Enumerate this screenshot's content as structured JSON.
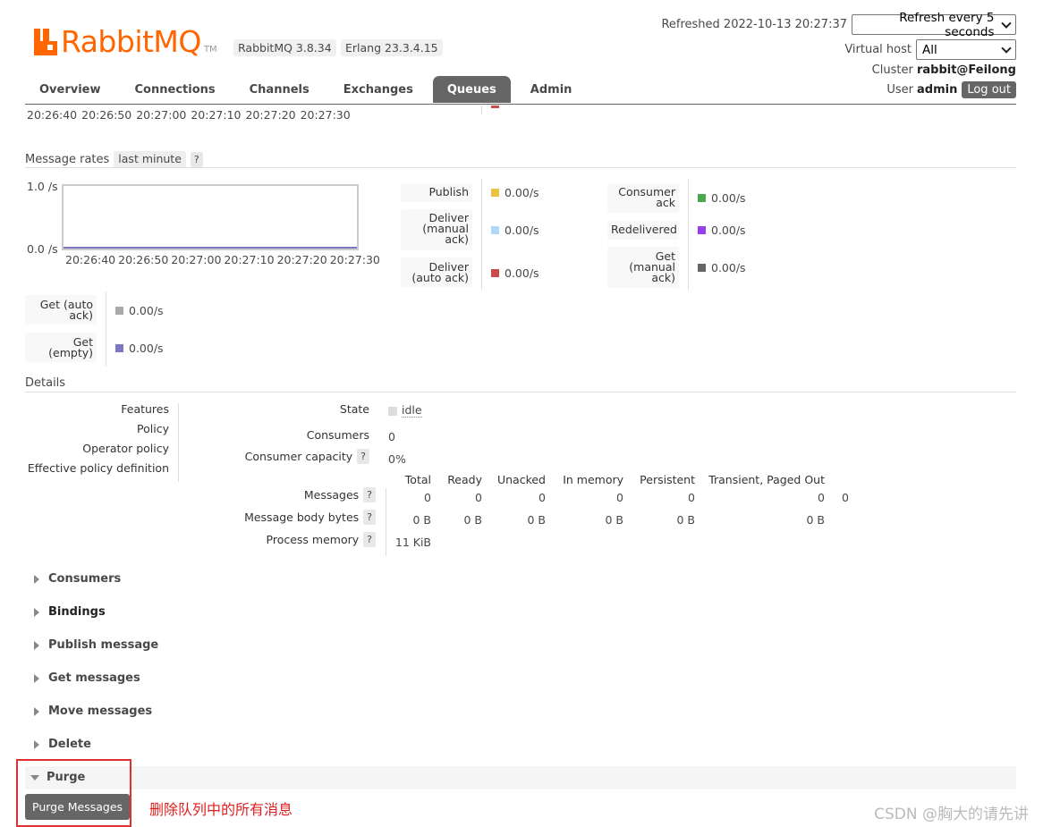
{
  "header": {
    "logo_text": "RabbitMQ",
    "logo_tm": "TM",
    "rabbit_version": "RabbitMQ 3.8.34",
    "erlang_version": "Erlang 23.3.4.15",
    "refreshed_label": "Refreshed 2022-10-13 20:27:37",
    "refresh_select": "Refresh every 5 seconds",
    "vhost_label": "Virtual host",
    "vhost_select": "All",
    "cluster_label": "Cluster",
    "cluster_name": "rabbit@Feilong",
    "user_label": "User",
    "user_name": "admin",
    "logout_label": "Log out"
  },
  "tabs": [
    {
      "label": "Overview"
    },
    {
      "label": "Connections"
    },
    {
      "label": "Channels"
    },
    {
      "label": "Exchanges"
    },
    {
      "label": "Queues"
    },
    {
      "label": "Admin"
    }
  ],
  "prev_chart_ticks": "20:26:40 20:26:50 20:27:00 20:27:10 20:27:20 20:27:30",
  "message_rates": {
    "title": "Message rates",
    "range": "last minute",
    "help": "?",
    "y_top": "1.0 /s",
    "y_bottom": "0.0 /s",
    "x_ticks": [
      "20:26:40",
      "20:26:50",
      "20:27:00",
      "20:27:10",
      "20:27:20",
      "20:27:30"
    ],
    "rates": [
      {
        "label": "Publish",
        "value": "0.00/s",
        "color": "#edc240"
      },
      {
        "label": "Deliver (manual ack)",
        "value": "0.00/s",
        "color": "#afd8f8"
      },
      {
        "label": "Deliver (auto ack)",
        "value": "0.00/s",
        "color": "#cb4b4b"
      },
      {
        "label": "Consumer ack",
        "value": "0.00/s",
        "color": "#4da74d"
      },
      {
        "label": "Redelivered",
        "value": "0.00/s",
        "color": "#9440ed"
      },
      {
        "label": "Get (manual ack)",
        "value": "0.00/s",
        "color": "#666666"
      },
      {
        "label": "Get (auto ack)",
        "value": "0.00/s",
        "color": "#aaaaaa"
      },
      {
        "label": "Get (empty)",
        "value": "0.00/s",
        "color": "#7c79c3"
      }
    ]
  },
  "details": {
    "title": "Details",
    "left_labels": [
      "Features",
      "Policy",
      "Operator policy",
      "Effective policy definition"
    ],
    "state_label": "State",
    "state_value": "idle",
    "consumers_label": "Consumers",
    "consumers_value": "0",
    "capacity_label": "Consumer capacity",
    "capacity_value": "0%",
    "columns": [
      "Total",
      "Ready",
      "Unacked",
      "In memory",
      "Persistent",
      "Transient, Paged Out"
    ],
    "rows": [
      {
        "label": "Messages",
        "values": [
          "0",
          "0",
          "0",
          "0",
          "0",
          "0"
        ],
        "extra": "0"
      },
      {
        "label": "Message body bytes",
        "values": [
          "0 B",
          "0 B",
          "0 B",
          "0 B",
          "0 B",
          "0 B"
        ]
      },
      {
        "label": "Process memory",
        "values": [
          "11 KiB"
        ]
      }
    ]
  },
  "sections": [
    {
      "label": "Consumers"
    },
    {
      "label": "Bindings"
    },
    {
      "label": "Publish message"
    },
    {
      "label": "Get messages"
    },
    {
      "label": "Move messages"
    },
    {
      "label": "Delete"
    }
  ],
  "purge": {
    "label": "Purge",
    "button": "Purge Messages",
    "annotation": "删除队列中的所有消息"
  },
  "watermark": "CSDN @胸大的请先讲"
}
